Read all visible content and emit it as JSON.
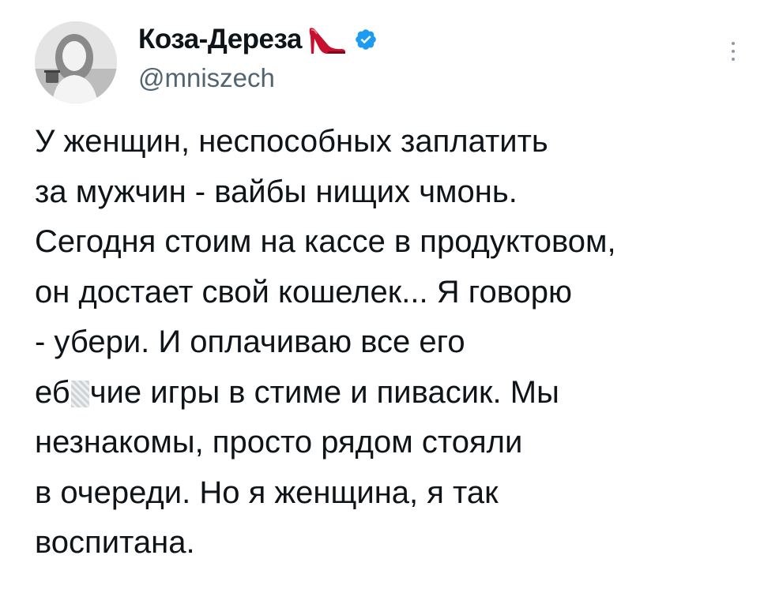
{
  "author": {
    "display_name": "Коза-Дереза",
    "handle": "@mniszech",
    "verified": true
  },
  "icons": {
    "avatar": "profile-photo",
    "heel": "high-heel-shoe-emoji",
    "verified": "verified-badge-icon",
    "more": "more-options-vertical-icon"
  },
  "colors": {
    "text": "#0f1419",
    "handle": "#536471",
    "verified": "#1d9bf0",
    "heel": "#c8102e"
  },
  "tweet": {
    "lines": [
      "У женщин, неспособных заплатить",
      "за мужчин - вайбы нищих чмонь.",
      "Сегодня стоим на кассе в продуктовом,",
      "он достает свой кошелек... Я говорю",
      "- убери. И оплачиваю все его",
      {
        "before": "еб",
        "after": "чие игры в стиме и пивасик. Мы"
      },
      "незнакомы, просто рядом стояли",
      "в очереди. Но я женщина, я так",
      "воспитана."
    ]
  }
}
